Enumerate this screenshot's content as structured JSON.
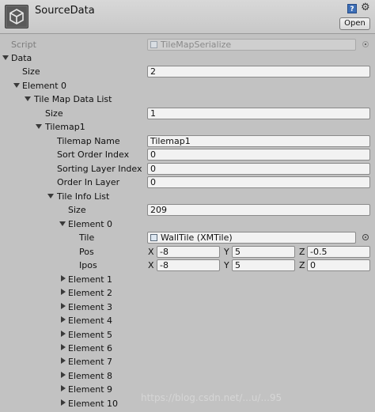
{
  "header": {
    "title": "SourceData",
    "open_label": "Open",
    "help_icon": "?",
    "gear_icon": "⚙"
  },
  "script": {
    "label": "Script",
    "value": "TileMapSerialize"
  },
  "data": {
    "label": "Data",
    "size_label": "Size",
    "size": "2",
    "element0": {
      "label": "Element 0",
      "tile_map_data_list": {
        "label": "Tile Map Data List",
        "size_label": "Size",
        "size": "1",
        "tilemap1": {
          "label": "Tilemap1",
          "fields": {
            "name_label": "Tilemap Name",
            "name": "Tilemap1",
            "sort_label": "Sort Order Index",
            "sort": "0",
            "sorting_layer_label": "Sorting Layer Index",
            "sorting_layer": "0",
            "order_label": "Order In Layer",
            "order": "0"
          },
          "tile_info_list": {
            "label": "Tile Info List",
            "size_label": "Size",
            "size": "209",
            "element0": {
              "label": "Element 0",
              "tile_label": "Tile",
              "tile": "WallTile (XMTile)",
              "pos_label": "Pos",
              "pos": {
                "x_label": "X",
                "x": "-8",
                "y_label": "Y",
                "y": "5",
                "z_label": "Z",
                "z": "-0.5"
              },
              "ipos_label": "Ipos",
              "ipos": {
                "x_label": "X",
                "x": "-8",
                "y_label": "Y",
                "y": "5",
                "z_label": "Z",
                "z": "0"
              }
            },
            "collapsed_elements": [
              "Element 1",
              "Element 2",
              "Element 3",
              "Element 4",
              "Element 5",
              "Element 6",
              "Element 7",
              "Element 8",
              "Element 9",
              "Element 10"
            ]
          }
        }
      }
    }
  },
  "watermark": "https://blog.csdn.net/...u/...95"
}
